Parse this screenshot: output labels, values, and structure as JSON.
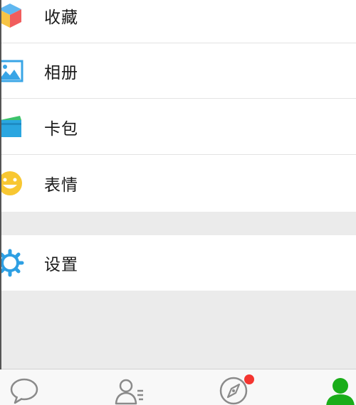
{
  "menu": {
    "items": [
      {
        "label": "收藏",
        "icon": "favorites-cube-icon"
      },
      {
        "label": "相册",
        "icon": "album-picture-icon"
      },
      {
        "label": "卡包",
        "icon": "card-wallet-icon"
      },
      {
        "label": "表情",
        "icon": "sticker-smiley-icon"
      }
    ],
    "settings": {
      "label": "设置",
      "icon": "settings-gear-icon"
    }
  },
  "tabbar": {
    "tabs": [
      {
        "icon": "chat-bubble-icon",
        "active": false
      },
      {
        "icon": "contacts-icon",
        "active": false
      },
      {
        "icon": "discover-compass-icon",
        "active": false,
        "badge": true
      },
      {
        "icon": "me-person-icon",
        "active": true
      }
    ]
  },
  "colors": {
    "active_tab": "#1aad19",
    "badge": "#f43530",
    "page_background": "#ebebeb",
    "inactive_icon": "#8a8a8a"
  }
}
